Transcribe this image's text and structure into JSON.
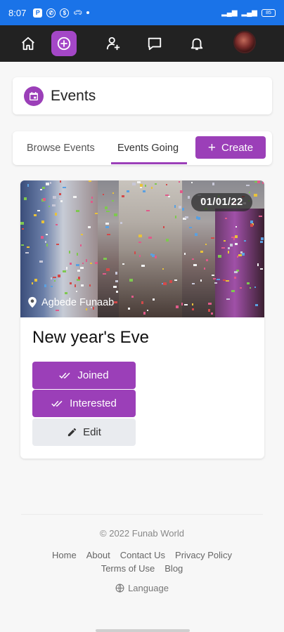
{
  "status_bar": {
    "time": "8:07",
    "battery": "85",
    "notif_p": "P"
  },
  "nav": {
    "items": [
      {
        "name": "home"
      },
      {
        "name": "create",
        "active": true
      },
      {
        "name": "people"
      },
      {
        "name": "messages"
      },
      {
        "name": "notifications"
      }
    ]
  },
  "header": {
    "title": "Events"
  },
  "tabs": {
    "browse": "Browse Events",
    "going": "Events Going",
    "create": "Create"
  },
  "event": {
    "date": "01/01/22",
    "location": "Agbede Funaab",
    "title": "New year's Eve",
    "joined_label": "Joined",
    "interested_label": "Interested",
    "edit_label": "Edit"
  },
  "footer": {
    "copyright": "© 2022 Funab World",
    "links_row1": [
      "Home",
      "About",
      "Contact Us",
      "Privacy Policy"
    ],
    "links_row2": [
      "Terms of Use",
      "Blog"
    ],
    "language": "Language"
  },
  "colors": {
    "accent": "#9b3fb8",
    "status_bar": "#1a73e8",
    "nav_bg": "#222222"
  }
}
